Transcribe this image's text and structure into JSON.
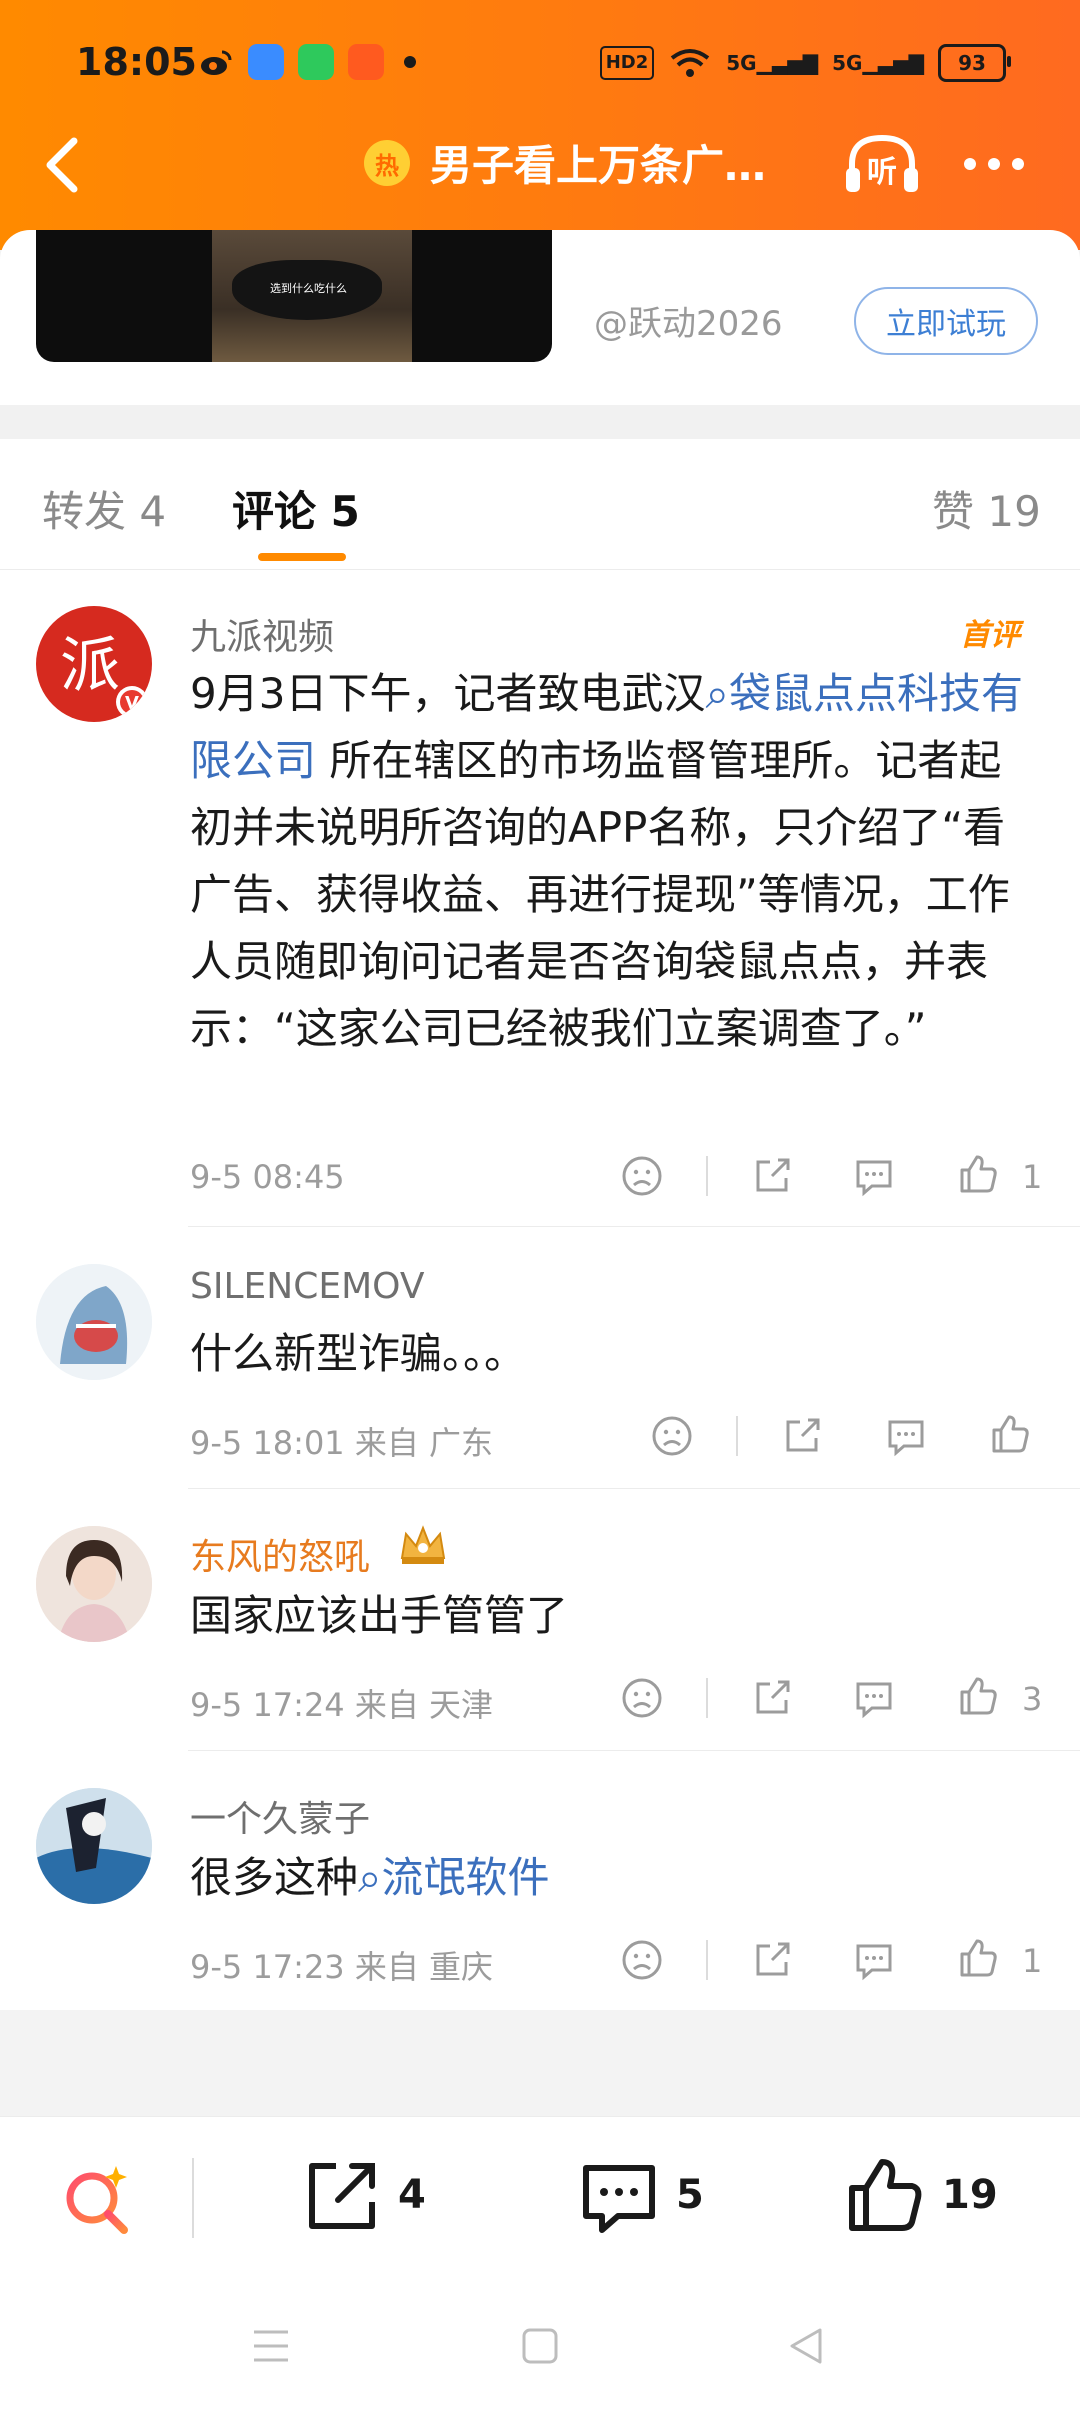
{
  "status": {
    "time": "18:05",
    "network": "HD2",
    "signal1": "5G",
    "signal2": "5G",
    "battery": "93"
  },
  "nav": {
    "hot_badge": "热",
    "title": "男子看上万条广…",
    "listen_label": "听"
  },
  "card": {
    "video_caption": "选到什么吃什么",
    "handle": "@跃动2026",
    "try_button": "立即试玩"
  },
  "tabs": {
    "repost": "转发 4",
    "comment": "评论 5",
    "like": "赞 19"
  },
  "comments": [
    {
      "user": "九派视频",
      "badge": "首评",
      "text_1": "9月3日下午，记者致电武汉",
      "link_1": "袋鼠点点科技有限公司",
      "text_2": "所在辖区的市场监督管理所。记者起初并未说明所咨询的APP名称，只介绍了“看广告、获得收益、再进行提现”等情况，工作人员随即询问记者是否咨询袋鼠点点，并表示：“这家公司已经被我们立案调查了。”",
      "time": "9-5 08:45",
      "likes": "1"
    },
    {
      "user": "SILENCEMOV",
      "text": "什么新型诈骗。。。",
      "time": "9-5 18:01 来自 广东",
      "likes": ""
    },
    {
      "user": "东风的怒吼",
      "text": "国家应该出手管管了",
      "time": "9-5 17:24 来自 天津",
      "likes": "3"
    },
    {
      "user": "一个久蒙子",
      "text_1": "很多这种",
      "link_1": "流氓软件",
      "time": "9-5 17:23 来自 重庆",
      "likes": "1"
    }
  ],
  "bottom_bar": {
    "repost_count": "4",
    "comment_count": "5",
    "like_count": "19"
  },
  "colors": {
    "header_orange": "#ff7a10",
    "link_blue": "#3b6fbd",
    "accent_orange": "#ff8a00"
  },
  "icons": [
    "back-icon",
    "listen-icon",
    "more-icon",
    "dislike-icon",
    "share-icon",
    "comment-icon",
    "like-icon",
    "search-spark-icon"
  ]
}
